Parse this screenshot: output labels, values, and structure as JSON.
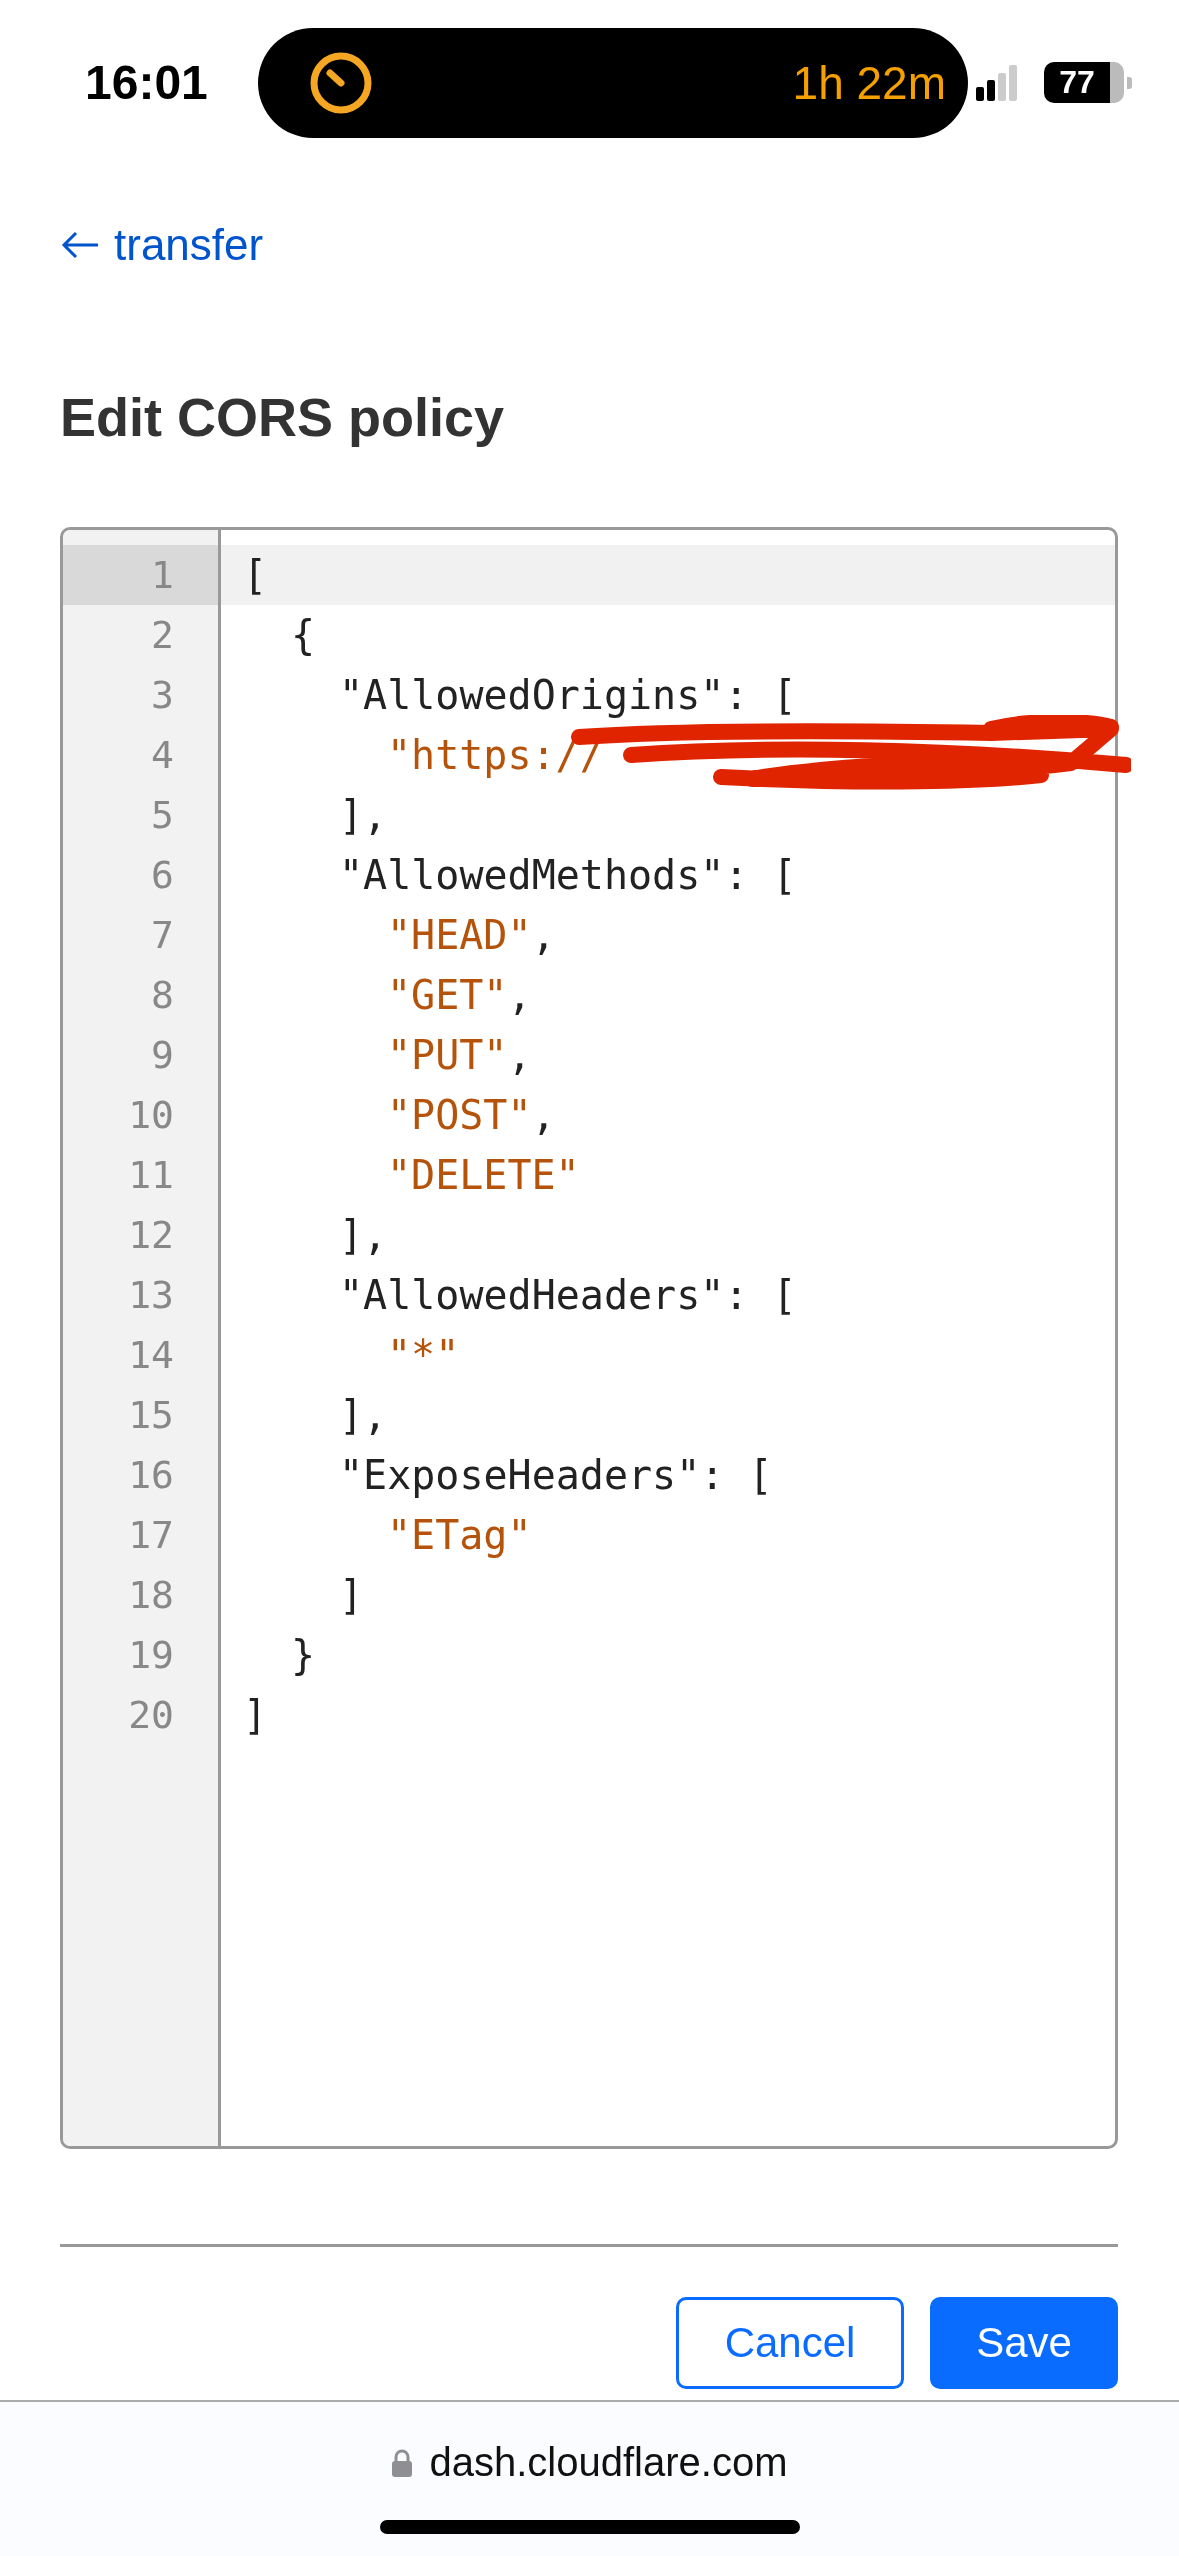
{
  "status_bar": {
    "time": "16:01",
    "timer": "1h 22m",
    "battery": "77"
  },
  "back_link": {
    "label": "transfer"
  },
  "title": "Edit CORS policy",
  "editor": {
    "lines": [
      {
        "number": "1",
        "selected": true,
        "redacted": false,
        "tokens": [
          {
            "kind": "punct",
            "text": "["
          }
        ]
      },
      {
        "number": "2",
        "selected": false,
        "redacted": false,
        "tokens": [
          {
            "kind": "punct",
            "text": "  {"
          }
        ]
      },
      {
        "number": "3",
        "selected": false,
        "redacted": false,
        "tokens": [
          {
            "kind": "key",
            "text": "    \"AllowedOrigins\""
          },
          {
            "kind": "punct",
            "text": ": ["
          }
        ]
      },
      {
        "number": "4",
        "selected": false,
        "redacted": true,
        "tokens": [
          {
            "kind": "string",
            "text": "      \"https://"
          }
        ]
      },
      {
        "number": "5",
        "selected": false,
        "redacted": false,
        "tokens": [
          {
            "kind": "punct",
            "text": "    ],"
          }
        ]
      },
      {
        "number": "6",
        "selected": false,
        "redacted": false,
        "tokens": [
          {
            "kind": "key",
            "text": "    \"AllowedMethods\""
          },
          {
            "kind": "punct",
            "text": ": ["
          }
        ]
      },
      {
        "number": "7",
        "selected": false,
        "redacted": false,
        "tokens": [
          {
            "kind": "string",
            "text": "      \"HEAD\""
          },
          {
            "kind": "punct",
            "text": ","
          }
        ]
      },
      {
        "number": "8",
        "selected": false,
        "redacted": false,
        "tokens": [
          {
            "kind": "string",
            "text": "      \"GET\""
          },
          {
            "kind": "punct",
            "text": ","
          }
        ]
      },
      {
        "number": "9",
        "selected": false,
        "redacted": false,
        "tokens": [
          {
            "kind": "string",
            "text": "      \"PUT\""
          },
          {
            "kind": "punct",
            "text": ","
          }
        ]
      },
      {
        "number": "10",
        "selected": false,
        "redacted": false,
        "tokens": [
          {
            "kind": "string",
            "text": "      \"POST\""
          },
          {
            "kind": "punct",
            "text": ","
          }
        ]
      },
      {
        "number": "11",
        "selected": false,
        "redacted": false,
        "tokens": [
          {
            "kind": "string",
            "text": "      \"DELETE\""
          }
        ]
      },
      {
        "number": "12",
        "selected": false,
        "redacted": false,
        "tokens": [
          {
            "kind": "punct",
            "text": "    ],"
          }
        ]
      },
      {
        "number": "13",
        "selected": false,
        "redacted": false,
        "tokens": [
          {
            "kind": "key",
            "text": "    \"AllowedHeaders\""
          },
          {
            "kind": "punct",
            "text": ": ["
          }
        ]
      },
      {
        "number": "14",
        "selected": false,
        "redacted": false,
        "tokens": [
          {
            "kind": "string",
            "text": "      \"*\""
          }
        ]
      },
      {
        "number": "15",
        "selected": false,
        "redacted": false,
        "tokens": [
          {
            "kind": "punct",
            "text": "    ],"
          }
        ]
      },
      {
        "number": "16",
        "selected": false,
        "redacted": false,
        "tokens": [
          {
            "kind": "key",
            "text": "    \"ExposeHeaders\""
          },
          {
            "kind": "punct",
            "text": ": ["
          }
        ]
      },
      {
        "number": "17",
        "selected": false,
        "redacted": false,
        "tokens": [
          {
            "kind": "string",
            "text": "      \"ETag\""
          }
        ]
      },
      {
        "number": "18",
        "selected": false,
        "redacted": false,
        "tokens": [
          {
            "kind": "punct",
            "text": "    ]"
          }
        ]
      },
      {
        "number": "19",
        "selected": false,
        "redacted": false,
        "tokens": [
          {
            "kind": "punct",
            "text": "  }"
          }
        ]
      },
      {
        "number": "20",
        "selected": false,
        "redacted": false,
        "tokens": [
          {
            "kind": "punct",
            "text": "]"
          }
        ]
      }
    ]
  },
  "buttons": [
    {
      "kind": "secondary",
      "label": "Cancel"
    },
    {
      "kind": "primary",
      "label": "Save"
    }
  ],
  "address_bar": {
    "url": "dash.cloudflare.com"
  }
}
